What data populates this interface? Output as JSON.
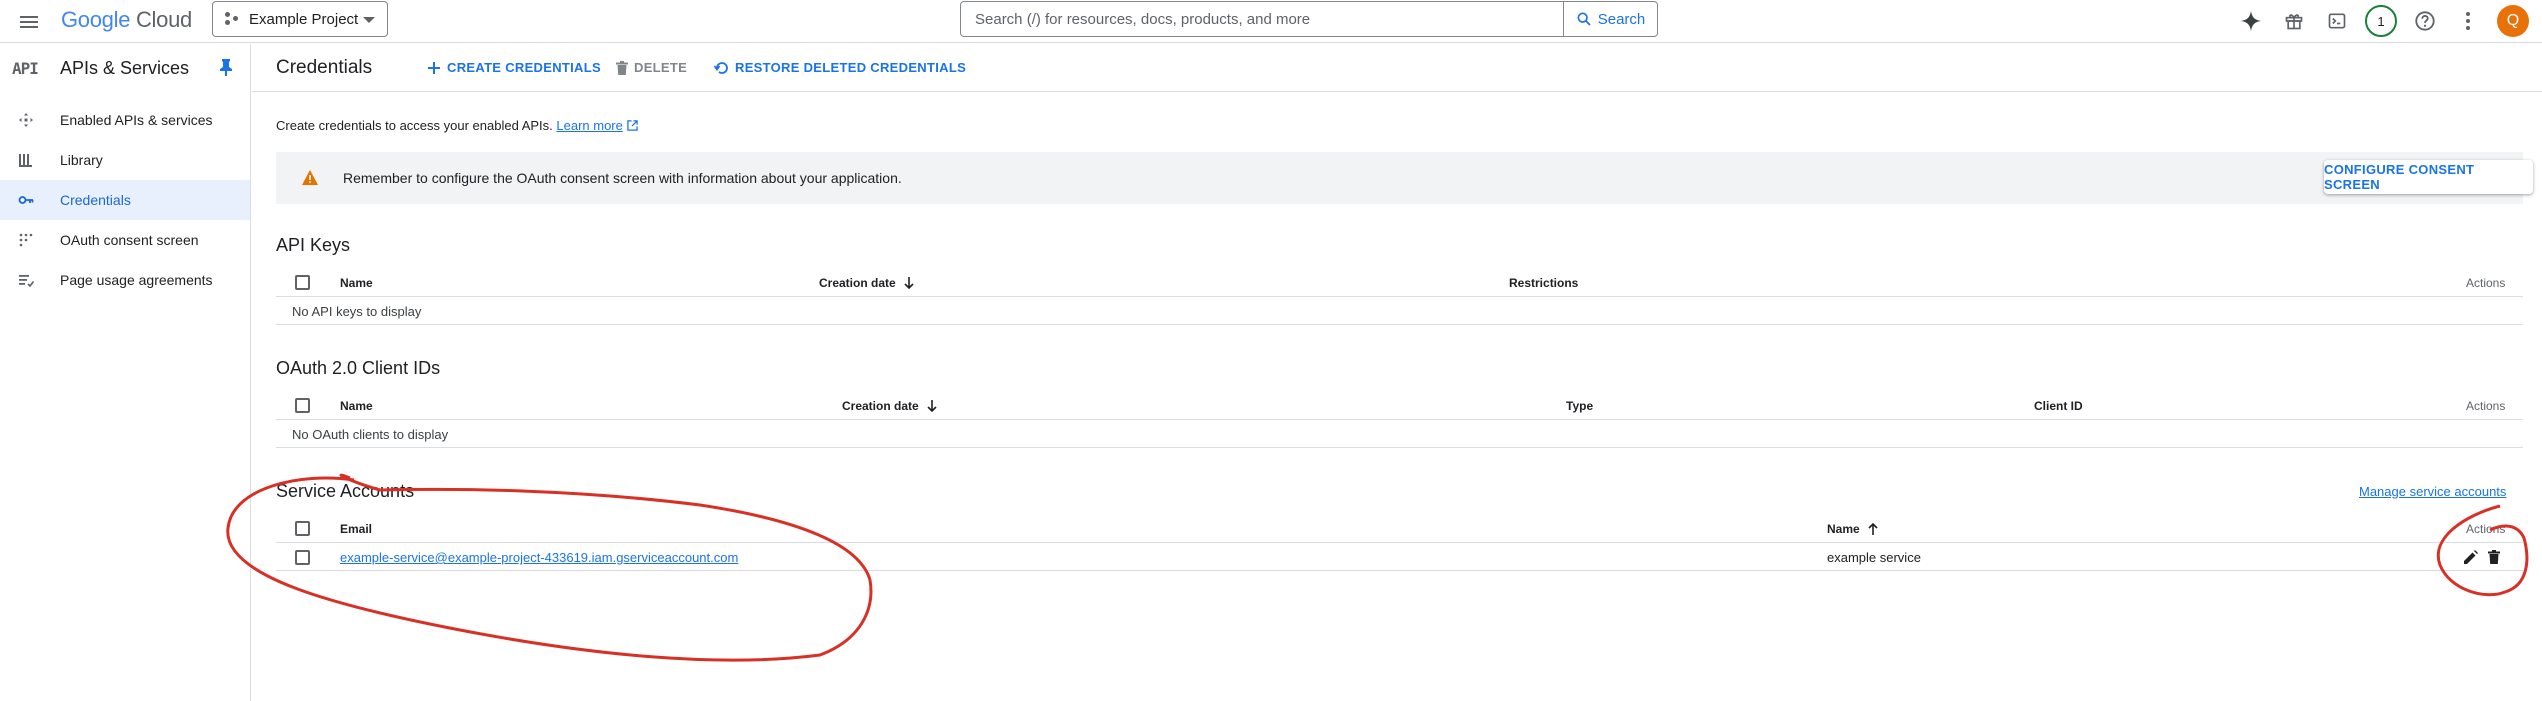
{
  "topbar": {
    "logo": {
      "google": "Google",
      "cloud": "Cloud"
    },
    "project": "Example Project",
    "search_placeholder": "Search (/) for resources, docs, products, and more",
    "search_button": "Search",
    "notifications_count": "1",
    "avatar_initial": "Q",
    "icons": [
      "menu-icon",
      "gemini-sparkle-icon",
      "gift-icon",
      "cloud-shell-icon",
      "help-icon",
      "more-vert-icon"
    ]
  },
  "sidebar": {
    "api_badge": "API",
    "title": "APIs & Services",
    "items": [
      {
        "label": "Enabled APIs & services",
        "icon": "enabled-apis-icon"
      },
      {
        "label": "Library",
        "icon": "library-icon"
      },
      {
        "label": "Credentials",
        "icon": "key-icon",
        "active": true
      },
      {
        "label": "OAuth consent screen",
        "icon": "oauth-icon"
      },
      {
        "label": "Page usage agreements",
        "icon": "agreements-icon"
      }
    ]
  },
  "header": {
    "title": "Credentials",
    "create": "CREATE CREDENTIALS",
    "delete": "DELETE",
    "restore": "RESTORE DELETED CREDENTIALS"
  },
  "intro": {
    "text": "Create credentials to access your enabled APIs.",
    "link": "Learn more"
  },
  "banner": {
    "message": "Remember to configure the OAuth consent screen with information about your application.",
    "button": "CONFIGURE CONSENT SCREEN"
  },
  "api_keys": {
    "title": "API Keys",
    "columns": {
      "name": "Name",
      "created": "Creation date",
      "restrictions": "Restrictions",
      "actions": "Actions"
    },
    "empty": "No API keys to display"
  },
  "oauth": {
    "title": "OAuth 2.0 Client IDs",
    "columns": {
      "name": "Name",
      "created": "Creation date",
      "type": "Type",
      "client_id": "Client ID",
      "actions": "Actions"
    },
    "empty": "No OAuth clients to display"
  },
  "service_accounts": {
    "title": "Service Accounts",
    "manage_link": "Manage service accounts",
    "columns": {
      "email": "Email",
      "name": "Name",
      "actions": "Actions"
    },
    "rows": [
      {
        "email": "example-service@example-project-433619.iam.gserviceaccount.com",
        "name": "example service"
      }
    ]
  },
  "colors": {
    "accent": "#1a73e8",
    "annotation": "#d93025",
    "warning": "#e37400"
  }
}
